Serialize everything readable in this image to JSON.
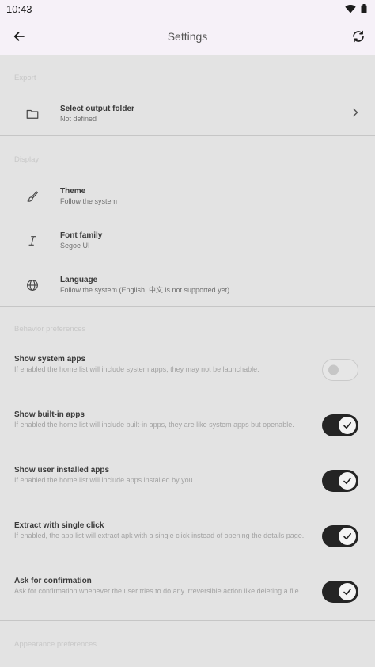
{
  "status_bar": {
    "time": "10:43",
    "wifi_icon": "wifi-icon",
    "battery_icon": "battery-icon"
  },
  "app_bar": {
    "title": "Settings",
    "back_icon": "arrow-back-icon",
    "refresh_icon": "refresh-icon"
  },
  "sections": {
    "export": {
      "header": "Export",
      "items": [
        {
          "icon": "folder-icon",
          "title": "Select output folder",
          "subtitle": "Not defined"
        }
      ]
    },
    "display": {
      "header": "Display",
      "items": [
        {
          "icon": "brush-icon",
          "title": "Theme",
          "subtitle": "Follow the system"
        },
        {
          "icon": "italic-icon",
          "title": "Font family",
          "subtitle": "Segoe UI"
        },
        {
          "icon": "globe-icon",
          "title": "Language",
          "subtitle": "Follow the system (English, 中文 is not supported yet)"
        }
      ]
    },
    "behavior": {
      "header": "Behavior preferences",
      "items": [
        {
          "title": "Show system apps",
          "subtitle": "If enabled the home list will include system apps, they may not be launchable.",
          "enabled": false
        },
        {
          "title": "Show built-in apps",
          "subtitle": "If enabled the home list will include built-in apps, they are like system apps but openable.",
          "enabled": true
        },
        {
          "title": "Show user installed apps",
          "subtitle": "If enabled the home list will include apps installed by you.",
          "enabled": true
        },
        {
          "title": "Extract with single click",
          "subtitle": "If enabled, the app list will extract apk with a single click instead of opening the details page.",
          "enabled": true
        },
        {
          "title": "Ask for confirmation",
          "subtitle": "Ask for confirmation whenever the user tries to do any irreversible action like deleting a file.",
          "enabled": true
        }
      ]
    },
    "appearance": {
      "header": "Appearance preferences"
    }
  }
}
